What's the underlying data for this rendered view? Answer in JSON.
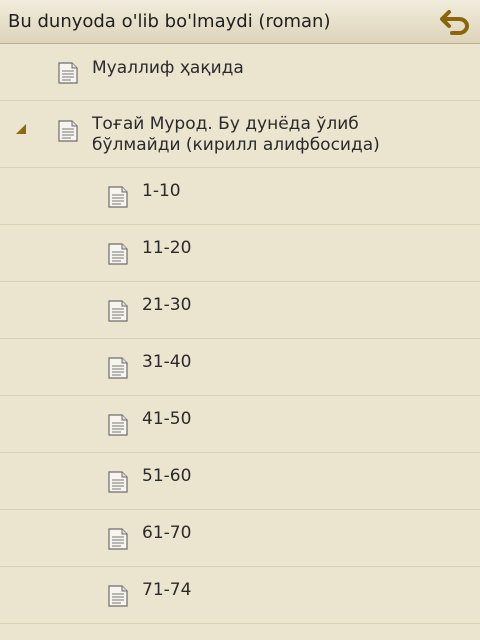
{
  "header": {
    "title": "Bu dunyoda o'lib bo'lmaydi (roman)",
    "back_icon": "back-arrow-icon"
  },
  "items": [
    {
      "label": "Муаллиф ҳақида"
    },
    {
      "label": "Тоғай Мурод. Бу дунёда ўлиб бўлмайди (кирилл алифбосида)",
      "expanded": true
    },
    {
      "label": "1-10"
    },
    {
      "label": "11-20"
    },
    {
      "label": "21-30"
    },
    {
      "label": "31-40"
    },
    {
      "label": "41-50"
    },
    {
      "label": "51-60"
    },
    {
      "label": "61-70"
    },
    {
      "label": "71-74"
    }
  ],
  "colors": {
    "background": "#ebe4cf",
    "accent": "#9a7413"
  }
}
